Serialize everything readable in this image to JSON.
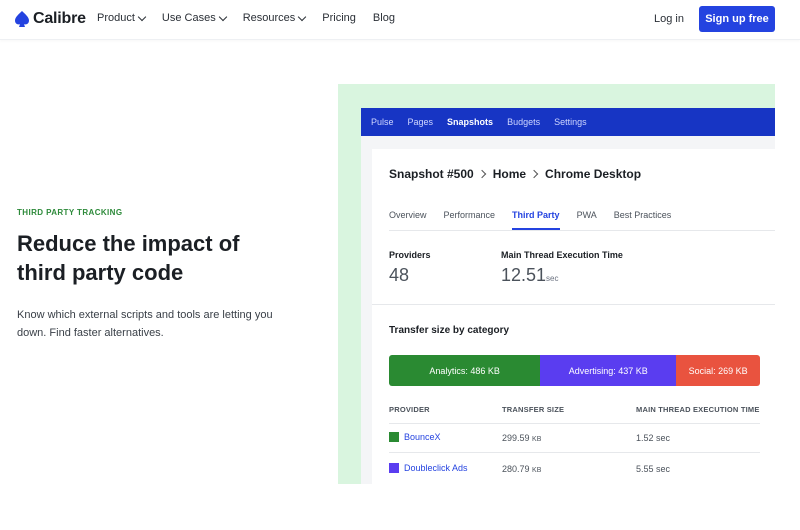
{
  "brand": {
    "name": "Calibre",
    "accent": "#2443e0"
  },
  "nav": {
    "items": [
      {
        "label": "Product",
        "dropdown": true
      },
      {
        "label": "Use Cases",
        "dropdown": true
      },
      {
        "label": "Resources",
        "dropdown": true
      },
      {
        "label": "Pricing",
        "dropdown": false
      },
      {
        "label": "Blog",
        "dropdown": false
      }
    ],
    "login": "Log in",
    "signup": "Sign up free"
  },
  "hero": {
    "eyebrow": "THIRD PARTY TRACKING",
    "headline_line1": "Reduce the impact of",
    "headline_line2": "third party code",
    "lede_line1": "Know which external scripts and tools are letting you",
    "lede_line2": "down. Find faster alternatives."
  },
  "app": {
    "tabs": [
      "Pulse",
      "Pages",
      "Snapshots",
      "Budgets",
      "Settings"
    ],
    "active_tab": "Snapshots",
    "breadcrumb": [
      "Snapshot #500",
      "Home",
      "Chrome Desktop"
    ],
    "subtabs": [
      "Overview",
      "Performance",
      "Third Party",
      "PWA",
      "Best Practices"
    ],
    "active_subtab": "Third Party",
    "metrics": {
      "providers_label": "Providers",
      "providers_value": "48",
      "exec_label": "Main Thread Execution Time",
      "exec_value": "12.51",
      "exec_unit": "sec"
    },
    "transfer": {
      "title": "Transfer size by category",
      "segments": [
        {
          "label": "Analytics: 486 KB",
          "kb": 486,
          "color": "#2a8a32"
        },
        {
          "label": "Advertising: 437 KB",
          "kb": 437,
          "color": "#5a3df0"
        },
        {
          "label": "Social: 269 KB",
          "kb": 269,
          "color": "#e9533f"
        }
      ]
    },
    "table": {
      "headers": [
        "PROVIDER",
        "TRANSFER SIZE",
        "MAIN THREAD EXECUTION TIME"
      ],
      "rows": [
        {
          "provider": "BounceX",
          "color": "#2a8a32",
          "size": "299.59",
          "size_unit": "KB",
          "time": "1.52 sec"
        },
        {
          "provider": "Doubleclick Ads",
          "color": "#5a3df0",
          "size": "280.79",
          "size_unit": "KB",
          "time": "5.55 sec"
        }
      ]
    }
  }
}
